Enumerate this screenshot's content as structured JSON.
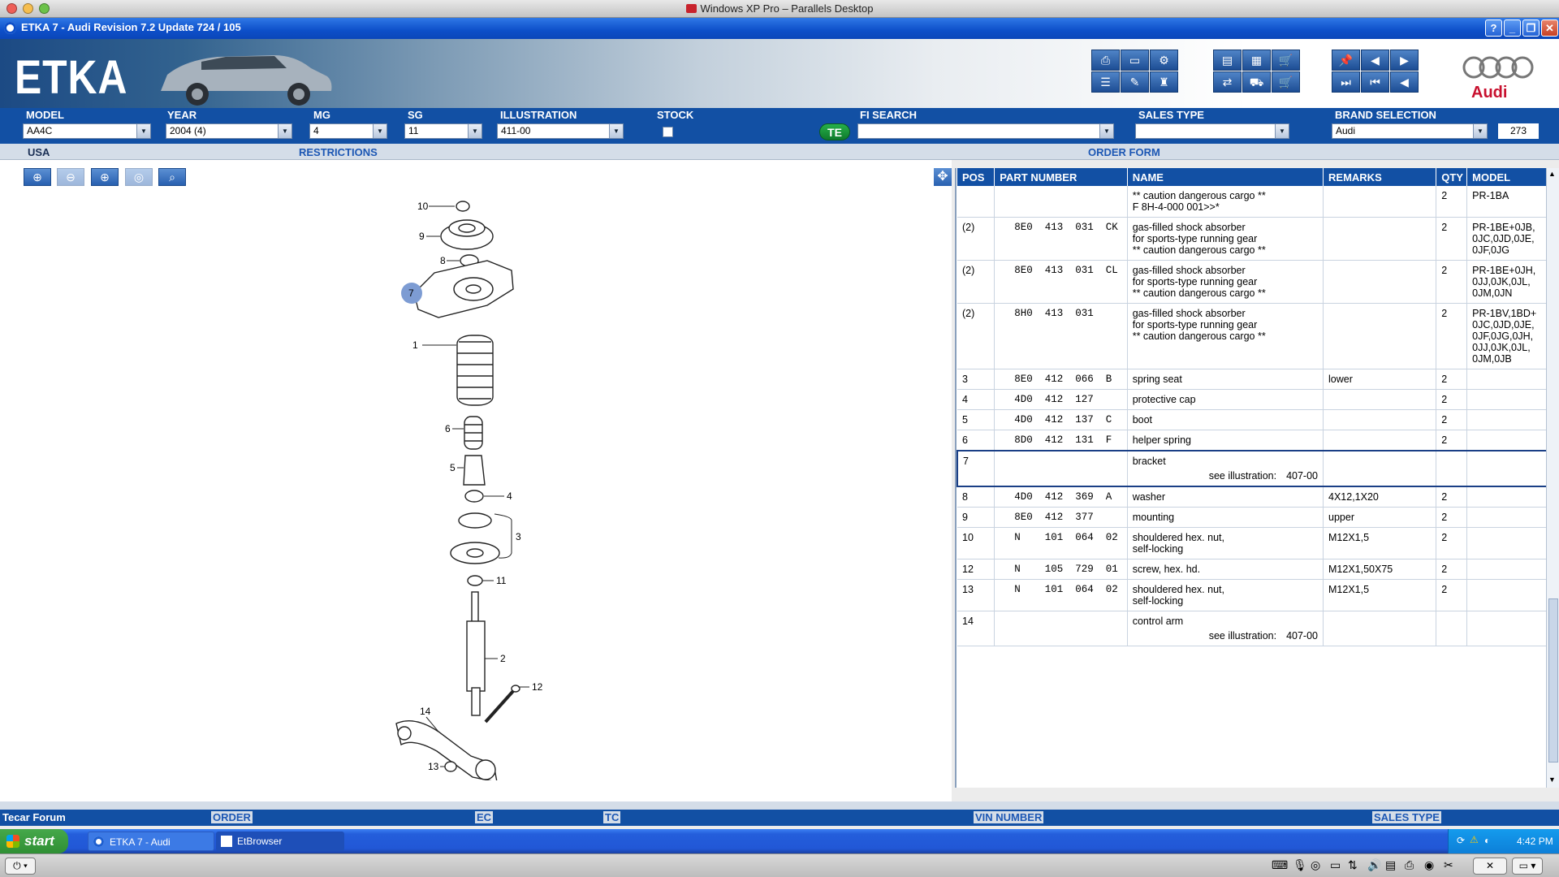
{
  "mac": {
    "title": "Windows XP Pro – Parallels Desktop"
  },
  "window": {
    "title": "ETKA 7 - Audi Revision 7.2 Update 724 / 105"
  },
  "banner": {
    "logo": "ETKA",
    "brand": "Audi"
  },
  "filters": {
    "model": {
      "label": "MODEL",
      "value": "AA4C"
    },
    "year": {
      "label": "YEAR",
      "value": "2004 (4)"
    },
    "mg": {
      "label": "MG",
      "value": "4"
    },
    "sg": {
      "label": "SG",
      "value": "11"
    },
    "illustration": {
      "label": "ILLUSTRATION",
      "value": "411-00"
    },
    "stock": {
      "label": "STOCK"
    },
    "te": "TE",
    "fi_search": {
      "label": "FI SEARCH",
      "value": ""
    },
    "sales_type": {
      "label": "SALES TYPE",
      "value": ""
    },
    "brand": {
      "label": "BRAND SELECTION",
      "value": "Audi"
    },
    "count": "273"
  },
  "infobar": {
    "market": "USA",
    "restrictions": "RESTRICTIONS",
    "order_form": "ORDER FORM"
  },
  "illustration_labels": [
    "10",
    "9",
    "8",
    "7",
    "1",
    "6",
    "5",
    "4",
    "3",
    "11",
    "2",
    "12",
    "14",
    "13"
  ],
  "parts": {
    "headers": [
      "POS",
      "PART NUMBER",
      "NAME",
      "REMARKS",
      "QTY",
      "MODEL"
    ],
    "rows": [
      {
        "pos": "",
        "part": "",
        "name": "** caution dangerous cargo  **\nF 8H-4-000 001>>*",
        "remarks": "",
        "qty": "2",
        "model": "PR-1BA"
      },
      {
        "pos": "(2)",
        "part": "8E0  413  031  CK",
        "name": "gas-filled shock absorber\nfor sports-type running gear\n** caution dangerous cargo  **",
        "remarks": "",
        "qty": "2",
        "model": "PR-1BE+0JB,\n0JC,0JD,0JE,\n0JF,0JG"
      },
      {
        "pos": "(2)",
        "part": "8E0  413  031  CL",
        "name": "gas-filled shock absorber\nfor sports-type running gear\n** caution dangerous cargo  **",
        "remarks": "",
        "qty": "2",
        "model": "PR-1BE+0JH,\n0JJ,0JK,0JL,\n0JM,0JN"
      },
      {
        "pos": "(2)",
        "part": "8H0  413  031",
        "name": "gas-filled shock absorber\nfor sports-type running gear\n** caution dangerous cargo  **",
        "remarks": "",
        "qty": "2",
        "model": "PR-1BV,1BD+\n0JC,0JD,0JE,\n0JF,0JG,0JH,\n0JJ,0JK,0JL,\n0JM,0JB"
      },
      {
        "pos": "3",
        "part": "8E0  412  066  B",
        "name": "spring seat",
        "remarks": "lower",
        "qty": "2",
        "model": ""
      },
      {
        "pos": "4",
        "part": "4D0  412  127",
        "name": "protective cap",
        "remarks": "",
        "qty": "2",
        "model": ""
      },
      {
        "pos": "5",
        "part": "4D0  412  137  C",
        "name": "boot",
        "remarks": "",
        "qty": "2",
        "model": ""
      },
      {
        "pos": "6",
        "part": "8D0  412  131  F",
        "name": "helper spring",
        "remarks": "",
        "qty": "2",
        "model": ""
      },
      {
        "pos": "7",
        "part": "",
        "name": "bracket",
        "see_label": "see illustration:",
        "see_value": "407-00",
        "remarks": "",
        "qty": "",
        "model": "",
        "selected": true
      },
      {
        "pos": "8",
        "part": "4D0  412  369  A",
        "name": "washer",
        "remarks": "4X12,1X20",
        "qty": "2",
        "model": ""
      },
      {
        "pos": "9",
        "part": "8E0  412  377",
        "name": "mounting",
        "remarks": "upper",
        "qty": "2",
        "model": ""
      },
      {
        "pos": "10",
        "part": "N    101  064  02",
        "name": "shouldered hex. nut,\nself-locking",
        "remarks": "M12X1,5",
        "qty": "2",
        "model": ""
      },
      {
        "pos": "12",
        "part": "N    105  729  01",
        "name": "screw, hex. hd.",
        "remarks": "M12X1,50X75",
        "qty": "2",
        "model": ""
      },
      {
        "pos": "13",
        "part": "N    101  064  02",
        "name": "shouldered hex. nut,\nself-locking",
        "remarks": "M12X1,5",
        "qty": "2",
        "model": ""
      },
      {
        "pos": "14",
        "part": "",
        "name": "control arm",
        "see_label": "see illustration:",
        "see_value": "407-00",
        "remarks": "",
        "qty": "",
        "model": ""
      }
    ]
  },
  "bottom": {
    "tecar": "Tecar Forum",
    "order": "ORDER",
    "ec": "EC",
    "tc": "TC",
    "vin": "VIN NUMBER",
    "sales_type": "SALES TYPE"
  },
  "taskbar": {
    "start": "start",
    "task1": "ETKA 7 - Audi",
    "task2": "EtBrowser",
    "time": "4:42 PM"
  }
}
